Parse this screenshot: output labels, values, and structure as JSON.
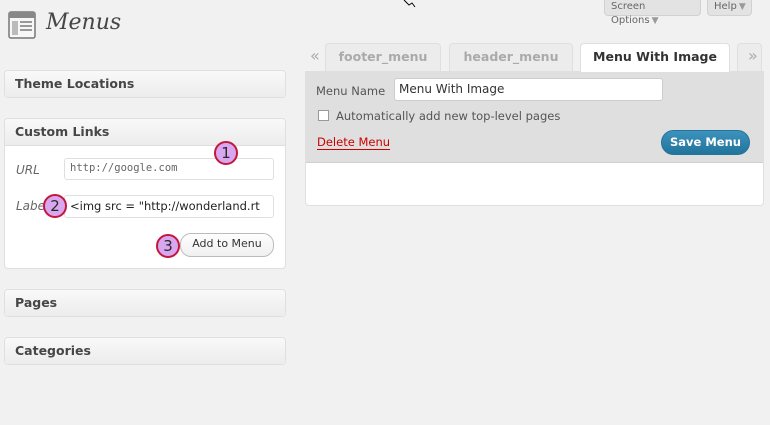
{
  "app": {
    "title": "Menus"
  },
  "screen_options": {
    "label": "Screen Options",
    "help_label": "Help"
  },
  "sidebar": {
    "theme_locations": "Theme Locations",
    "custom_links": {
      "title": "Custom Links",
      "url_label": "URL",
      "url_value": "http://google.com",
      "label_label": "Label",
      "label_value": "<img src = \"http://wonderland.rt",
      "add_button": "Add to Menu"
    },
    "pages": "Pages",
    "categories": "Categories"
  },
  "markers": [
    "1",
    "2",
    "3"
  ],
  "tabs": {
    "left_arrow": "«",
    "right_arrow": "»",
    "items": [
      "footer_menu",
      "header_menu",
      "Menu With Image"
    ],
    "active_index": 2
  },
  "menu_editor": {
    "name_label": "Menu Name",
    "name_value": "Menu With Image",
    "auto_add_label": "Automatically add new top-level pages",
    "auto_add_checked": false,
    "delete_label": "Delete Menu",
    "save_label": "Save Menu"
  },
  "colors": {
    "accent": "#21759b",
    "delete": "#cc0000",
    "marker_fill": "#d9a6f0",
    "marker_border": "#c2183b"
  }
}
